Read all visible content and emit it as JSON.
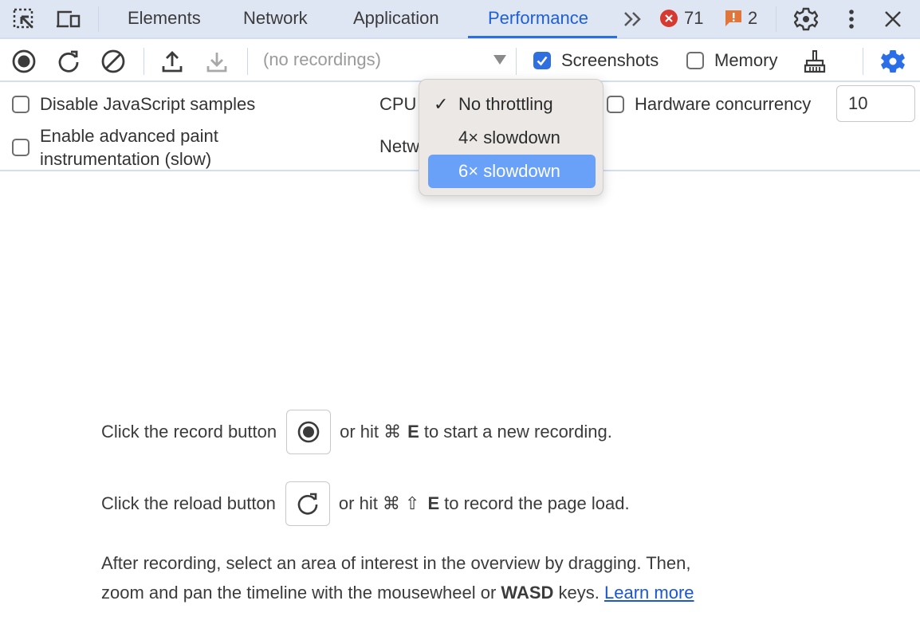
{
  "tabbar": {
    "tabs": [
      {
        "label": "Elements",
        "active": false
      },
      {
        "label": "Network",
        "active": false
      },
      {
        "label": "Application",
        "active": false
      },
      {
        "label": "Performance",
        "active": true
      }
    ],
    "more_tabs_icon": "double-chevron-right-icon",
    "errors_count": "71",
    "warnings_count": "2",
    "colors": {
      "active_tab": "#1f5fd6",
      "error": "#d6392f",
      "warning": "#e2763a"
    }
  },
  "toolbar": {
    "recordings_placeholder": "(no recordings)",
    "screenshots_label": "Screenshots",
    "screenshots_checked": true,
    "memory_label": "Memory",
    "memory_checked": false
  },
  "settings": {
    "disable_js_samples_label": "Disable JavaScript samples",
    "disable_js_samples_checked": false,
    "advanced_paint_label_line1": "Enable advanced paint",
    "advanced_paint_label_line2": "instrumentation (slow)",
    "advanced_paint_checked": false,
    "cpu_label": "CPU",
    "network_label": "Netw",
    "hardware_concurrency_label": "Hardware concurrency",
    "hardware_concurrency_checked": false,
    "hardware_concurrency_value": "10"
  },
  "cpu_dropdown": {
    "options": [
      {
        "label": "No throttling",
        "selected": true,
        "highlighted": false
      },
      {
        "label": "4× slowdown",
        "selected": false,
        "highlighted": false
      },
      {
        "label": "6× slowdown",
        "selected": false,
        "highlighted": true
      }
    ],
    "check_glyph": "✓"
  },
  "landing": {
    "record_hint_pre": "Click the record button",
    "record_hint_mid": "or hit ⌘",
    "record_hint_key": "E",
    "record_hint_post": "to start a new recording.",
    "reload_hint_pre": "Click the reload button",
    "reload_hint_mid": "or hit ⌘ ⇧",
    "reload_hint_key": "E",
    "reload_hint_post": "to record the page load.",
    "para_line1": "After recording, select an area of interest in the overview by dragging. Then,",
    "para_line2_pre": "zoom and pan the timeline with the mousewheel or",
    "para_line2_bold": "WASD",
    "para_line2_post": "keys.",
    "learn_more": "Learn more"
  }
}
